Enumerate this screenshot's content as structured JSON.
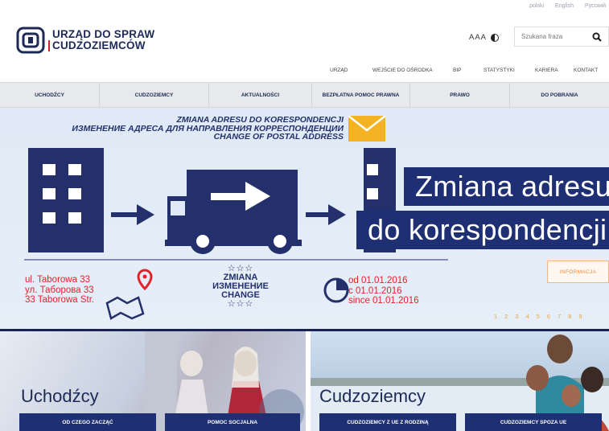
{
  "header": {
    "logo_line1": "URZĄD DO SPRAW",
    "logo_line2": "CUDZOZIEMCÓW",
    "top_links": [
      "polski",
      "English",
      "Русский"
    ],
    "a11y_text": "AAA",
    "search_placeholder": "Szukana fraza"
  },
  "subnav": [
    "URZĄD",
    "WEJŚCIE DO OŚRODKA",
    "BIP",
    "STATYSTYKI",
    "KARIERA",
    "KONTAKT"
  ],
  "mainnav": [
    "UCHODŹCY",
    "CUDZOZIEMCY",
    "AKTUALNOŚCI",
    "BEZPŁATNA POMOC PRAWNA",
    "PRAWO",
    "DO POBRANIA"
  ],
  "banner": {
    "title_pl": "ZMIANA ADRESU DO KORESPONDENCJI",
    "title_ru": "ИЗМЕНЕНИЕ АДРЕСА ДЛЯ НАПРАВЛЕНИЯ КОРРЕСПОНДЕНЦИИ",
    "title_en": "CHANGE OF POSTAL ADDRESS",
    "big_line1": "Zmiana adresu",
    "big_line2": "do korespondencji",
    "address": [
      "ul. Taborowa 33",
      "ул. Таборова 33",
      "33 Taborowa Str."
    ],
    "change": [
      "ZMIANA",
      "ИЗМЕНЕНИЕ",
      "CHANGE"
    ],
    "dates": [
      "od 01.01.2016",
      "с 01.01.2016",
      "since 01.01.2016"
    ],
    "info_button": "INFORMACJA",
    "pager": [
      "1",
      "2",
      "3",
      "4",
      "5",
      "6",
      "7",
      "8",
      "9"
    ]
  },
  "tiles": {
    "left_title": "Uchodźcy",
    "left_buttons": [
      "OD CZEGO ZACZĄĆ",
      "POMOC SOCJALNA"
    ],
    "right_title": "Cudzoziemcy",
    "right_buttons": [
      "CUDZOZIEMCY Z UE Z RODZINĄ",
      "CUDZOZIEMCY SPOZA UE"
    ]
  },
  "colors": {
    "navy": "#1e2f73",
    "red": "#e2232a",
    "orange": "#f08a3c"
  }
}
